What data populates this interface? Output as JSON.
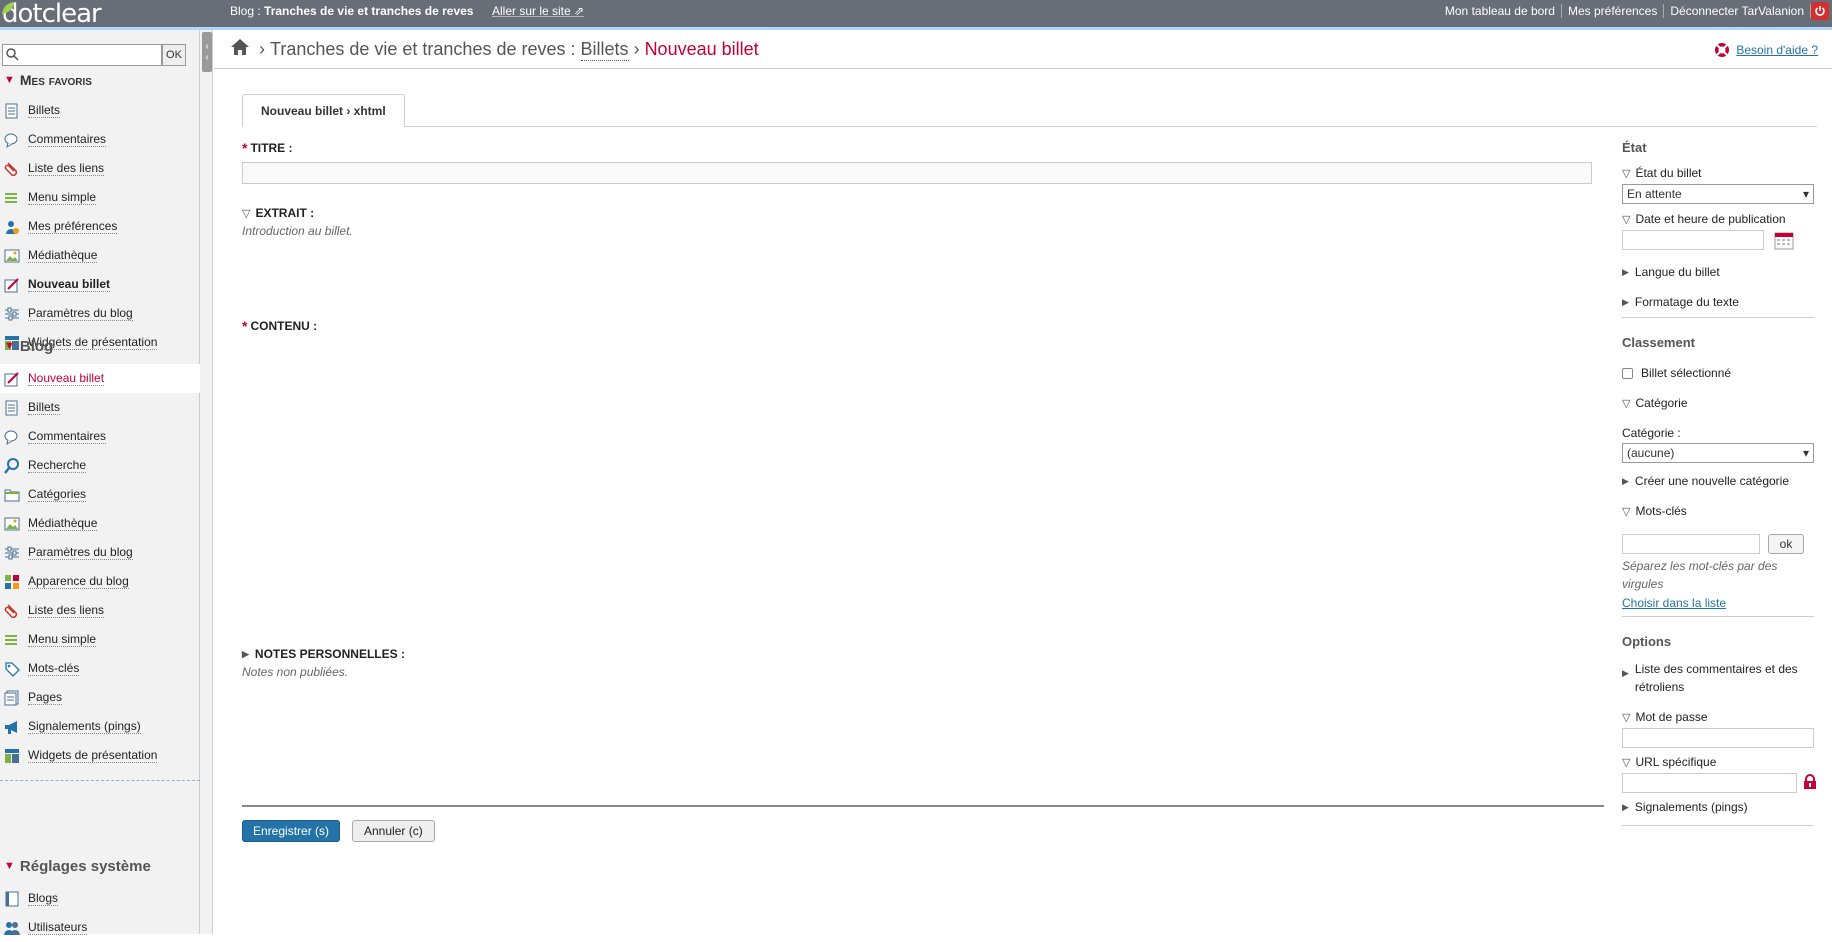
{
  "topbar": {
    "logo": "dotclear",
    "blog_prefix": "Blog :",
    "blog_name": "Tranches de vie et tranches de reves",
    "visit_site": "Aller sur le site",
    "dashboard": "Mon tableau de bord",
    "preferences": "Mes préférences",
    "logout": "Déconnecter TarValanion"
  },
  "sidebar": {
    "search_placeholder": "",
    "ok_label": "OK",
    "favorites": {
      "title": "Mes favoris",
      "items": [
        {
          "label": "Billets"
        },
        {
          "label": "Commentaires"
        },
        {
          "label": "Liste des liens"
        },
        {
          "label": "Menu simple"
        },
        {
          "label": "Mes préférences"
        },
        {
          "label": "Médiathèque"
        },
        {
          "label": "Nouveau billet"
        },
        {
          "label": "Paramètres du blog"
        },
        {
          "label": "Widgets de présentation"
        }
      ]
    },
    "blog": {
      "title": "Blog",
      "items": [
        {
          "label": "Nouveau billet"
        },
        {
          "label": "Billets"
        },
        {
          "label": "Commentaires"
        },
        {
          "label": "Recherche"
        },
        {
          "label": "Catégories"
        },
        {
          "label": "Médiathèque"
        },
        {
          "label": "Paramètres du blog"
        },
        {
          "label": "Apparence du blog"
        },
        {
          "label": "Liste des liens"
        },
        {
          "label": "Menu simple"
        },
        {
          "label": "Mots-clés"
        },
        {
          "label": "Pages"
        },
        {
          "label": "Signalements (pings)"
        },
        {
          "label": "Widgets de présentation"
        }
      ]
    },
    "system": {
      "title": "Réglages système",
      "items": [
        {
          "label": "Blogs"
        },
        {
          "label": "Utilisateurs"
        }
      ]
    }
  },
  "breadcrumb": {
    "blog": "Tranches de vie et tranches de reves",
    "colon": ":",
    "section": "Billets",
    "current": "Nouveau billet"
  },
  "help": "Besoin d'aide ?",
  "tab": "Nouveau billet › xhtml",
  "form": {
    "title_label": "Titre :",
    "excerpt_label": "Extrait :",
    "excerpt_hint": "Introduction au billet.",
    "content_label": "Contenu :",
    "notes_label": "Notes personnelles :",
    "notes_hint": "Notes non publiées.",
    "save": "Enregistrer (s)",
    "cancel": "Annuler (c)"
  },
  "panel": {
    "state_title": "État",
    "post_state": "État du billet",
    "post_state_value": "En attente",
    "pub_date": "Date et heure de publication",
    "lang": "Langue du billet",
    "format": "Formatage du texte",
    "ranking_title": "Classement",
    "selected": "Billet sélectionné",
    "category_toggle": "Catégorie",
    "category_label": "Catégorie :",
    "category_value": "(aucune)",
    "new_category": "Créer une nouvelle catégorie",
    "tags": "Mots-clés",
    "tags_ok": "ok",
    "tags_hint": "Séparez les mot-clés par des virgules",
    "choose_list": "Choisir dans la liste",
    "options_title": "Options",
    "comments_list": "Liste des commentaires et des rétroliens",
    "password": "Mot de passe",
    "url": "URL spécifique",
    "pings": "Signalements (pings)"
  }
}
